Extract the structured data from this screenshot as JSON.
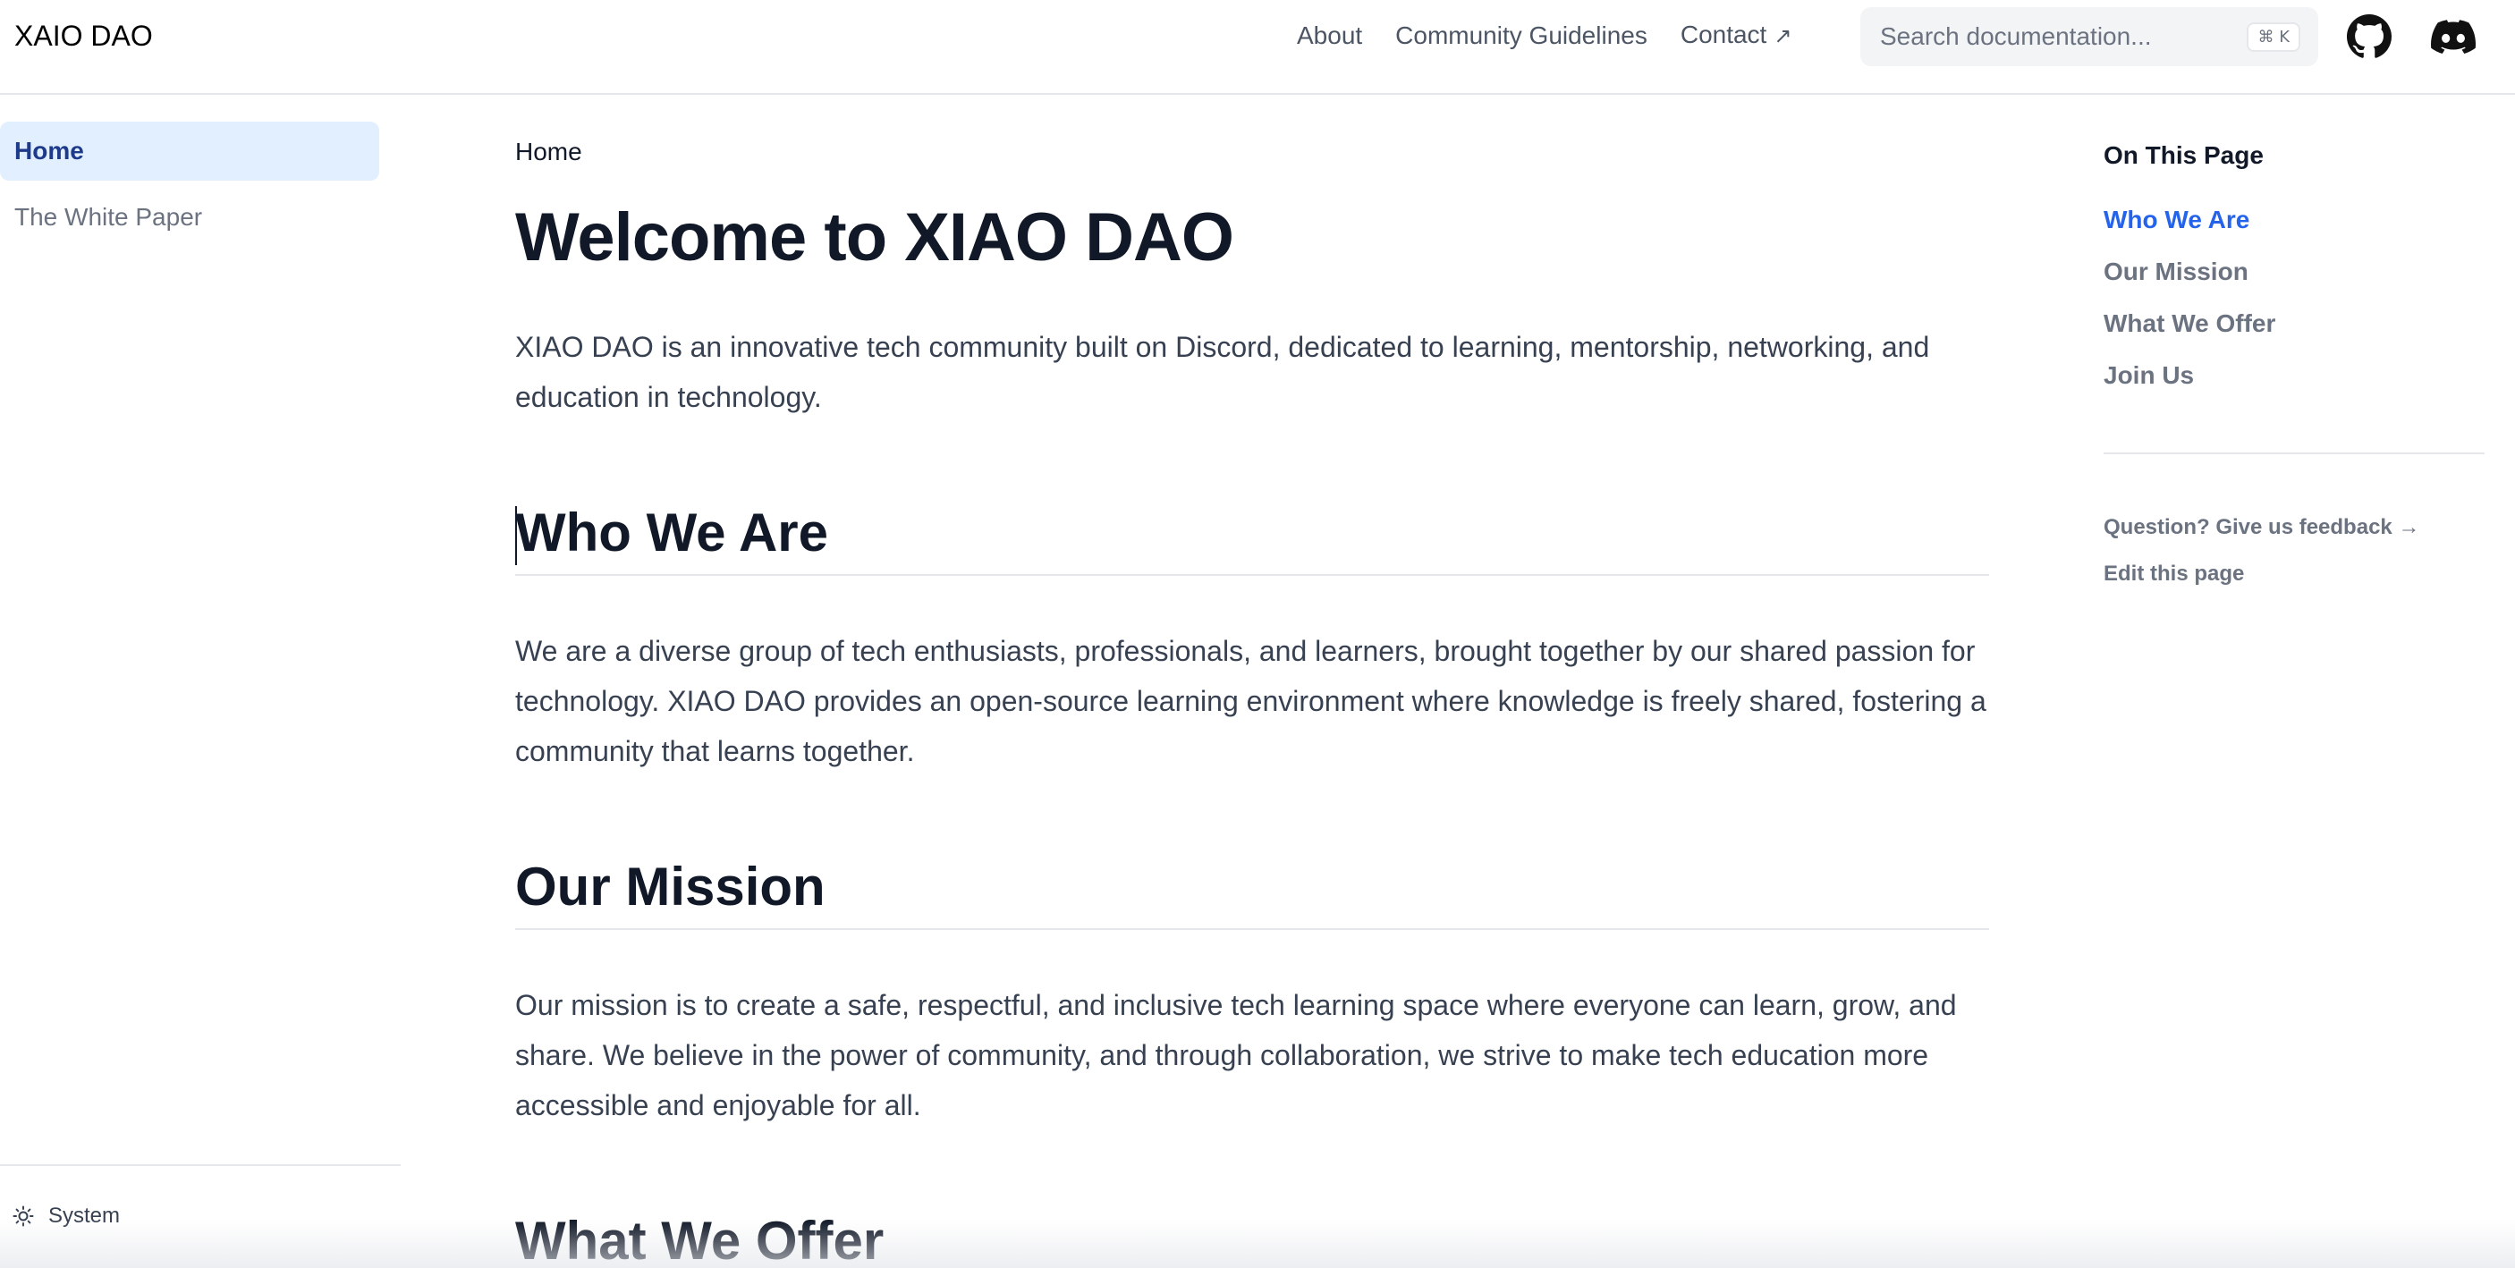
{
  "header": {
    "logo": "XAIO DAO",
    "nav": [
      {
        "label": "About"
      },
      {
        "label": "Community Guidelines"
      },
      {
        "label": "Contact"
      }
    ],
    "contact_arrow": "↗",
    "search": {
      "placeholder": "Search documentation...",
      "shortcut": "⌘ K"
    },
    "icons": [
      "github-icon",
      "discord-icon"
    ]
  },
  "sidebar": {
    "items": [
      {
        "label": "Home",
        "active": true
      },
      {
        "label": "The White Paper",
        "active": false
      }
    ],
    "theme_label": "System",
    "theme_icon": "sun-icon"
  },
  "main": {
    "breadcrumb": "Home",
    "title": "Welcome to XIAO DAO",
    "intro": "XIAO DAO is an innovative tech community built on Discord, dedicated to learning, mentorship, networking, and education in technology.",
    "sections": [
      {
        "heading": "Who We Are",
        "body": "We are a diverse group of tech enthusiasts, professionals, and learners, brought together by our shared passion for technology. XIAO DAO provides an open-source learning environment where knowledge is freely shared, fostering a community that learns together."
      },
      {
        "heading": "Our Mission",
        "body": "Our mission is to create a safe, respectful, and inclusive tech learning space where everyone can learn, grow, and share. We believe in the power of community, and through collaboration, we strive to make tech education more accessible and enjoyable for all."
      },
      {
        "heading": "What We Offer",
        "body": ""
      }
    ]
  },
  "toc": {
    "title": "On This Page",
    "items": [
      {
        "label": "Who We Are",
        "active": true
      },
      {
        "label": "Our Mission",
        "active": false
      },
      {
        "label": "What We Offer",
        "active": false
      },
      {
        "label": "Join Us",
        "active": false
      }
    ],
    "feedback": "Question? Give us feedback →",
    "edit": "Edit this page"
  },
  "colors": {
    "accent": "#2563eb",
    "active_bg": "#e1effe",
    "active_text": "#1e3a8a",
    "muted_text": "#6b7280",
    "body_text": "#374151",
    "heading_text": "#111827",
    "border": "#e5e7eb"
  }
}
